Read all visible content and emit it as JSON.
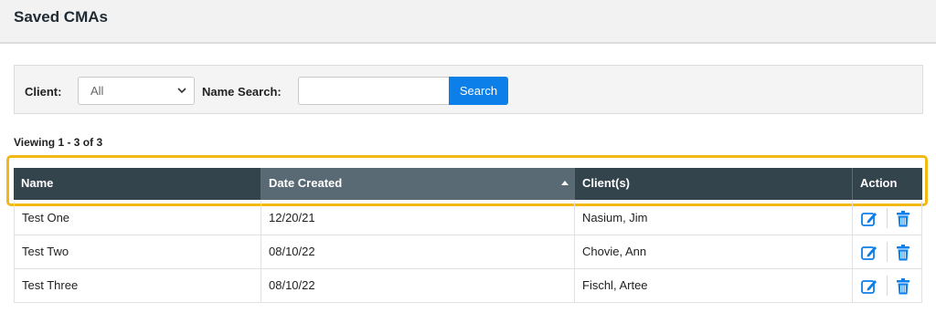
{
  "page": {
    "title": "Saved CMAs"
  },
  "filters": {
    "client_label": "Client:",
    "client_value": "All",
    "name_search_label": "Name Search:",
    "name_search_value": "",
    "search_button": "Search"
  },
  "results": {
    "summary": "Viewing 1 - 3 of 3"
  },
  "table": {
    "columns": [
      "Name",
      "Date Created",
      "Client(s)",
      "Action"
    ],
    "sorted_column": "Date Created",
    "rows": [
      {
        "name": "Test One",
        "date": "12/20/21",
        "client": "Nasium, Jim"
      },
      {
        "name": "Test Two",
        "date": "08/10/22",
        "client": "Chovie, Ann"
      },
      {
        "name": "Test Three",
        "date": "08/10/22",
        "client": "Fischl, Artee"
      }
    ]
  },
  "colors": {
    "accent": "#0d7fe9",
    "header_bg": "#34444d",
    "highlight": "#f4b813"
  },
  "icons": {
    "edit": "edit-icon",
    "delete": "trash-icon",
    "dropdown": "chevron-down-icon"
  }
}
